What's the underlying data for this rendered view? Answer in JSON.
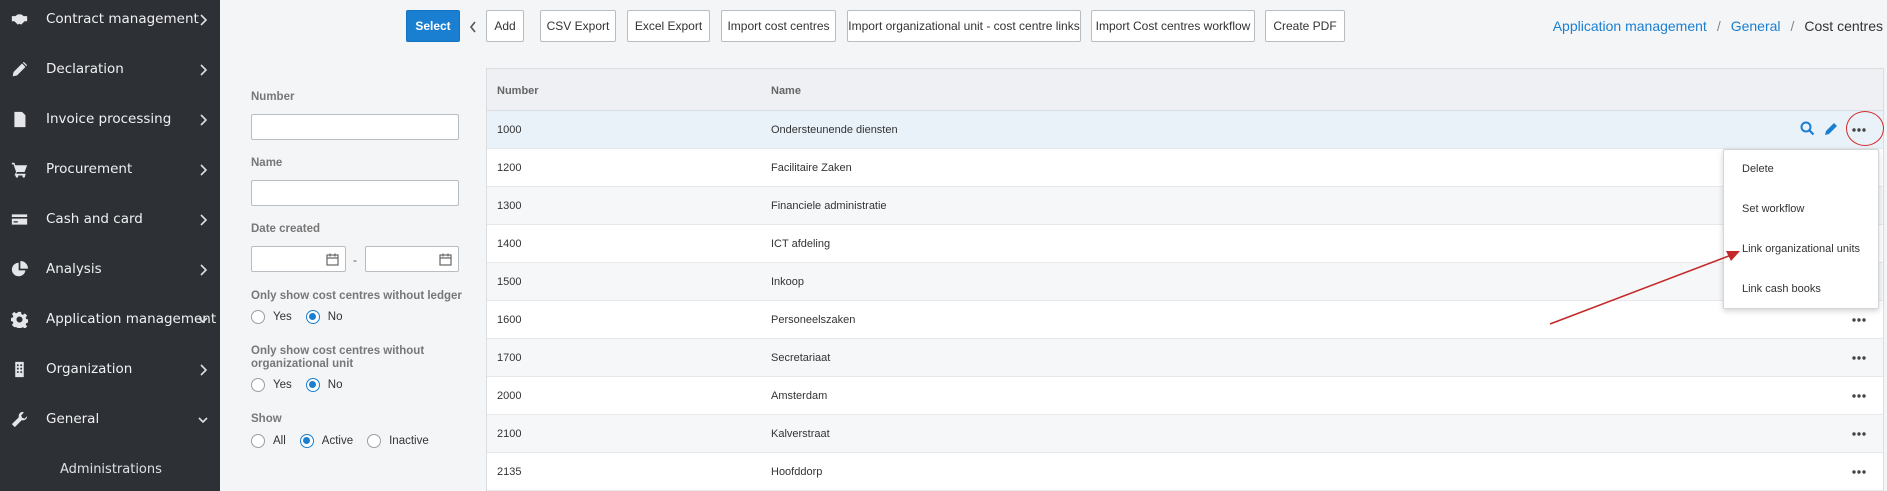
{
  "sidebar": {
    "items": [
      {
        "label": "Contract management",
        "icon": "handshake-icon",
        "chevron": "right"
      },
      {
        "label": "Declaration",
        "icon": "pencil-icon",
        "chevron": "right"
      },
      {
        "label": "Invoice processing",
        "icon": "invoice-icon",
        "chevron": "right"
      },
      {
        "label": "Procurement",
        "icon": "cart-icon",
        "chevron": "right"
      },
      {
        "label": "Cash and card",
        "icon": "card-icon",
        "chevron": "right"
      },
      {
        "label": "Analysis",
        "icon": "pie-chart-icon",
        "chevron": "right"
      },
      {
        "label": "Application management",
        "icon": "gear-icon",
        "chevron": "down"
      },
      {
        "label": "Organization",
        "icon": "building-icon",
        "chevron": "right"
      },
      {
        "label": "General",
        "icon": "wrench-icon",
        "chevron": "down"
      }
    ],
    "sub_item": "Administrations"
  },
  "toolbar": {
    "select": "Select",
    "add": "Add",
    "csv_export": "CSV Export",
    "excel_export": "Excel Export",
    "import_cost_centres": "Import cost centres",
    "import_org_links": "Import organizational unit - cost centre links",
    "import_workflow": "Import Cost centres workflow",
    "create_pdf": "Create PDF"
  },
  "breadcrumb": {
    "app_mgmt": "Application management",
    "general": "General",
    "current": "Cost centres",
    "sep": "/"
  },
  "filters": {
    "number_label": "Number",
    "name_label": "Name",
    "date_label": "Date created",
    "date_sep": "-",
    "ledger_label": "Only show cost centres without ledger",
    "orgunit_label_1": "Only show cost centres without",
    "orgunit_label_2": "organizational unit",
    "show_label": "Show",
    "yes": "Yes",
    "no": "No",
    "all": "All",
    "active": "Active",
    "inactive": "Inactive"
  },
  "table": {
    "col_number": "Number",
    "col_name": "Name",
    "rows": [
      {
        "number": "1000",
        "name": "Ondersteunende diensten"
      },
      {
        "number": "1200",
        "name": "Facilitaire Zaken"
      },
      {
        "number": "1300",
        "name": "Financiele administratie"
      },
      {
        "number": "1400",
        "name": "ICT afdeling"
      },
      {
        "number": "1500",
        "name": "Inkoop"
      },
      {
        "number": "1600",
        "name": "Personeelszaken"
      },
      {
        "number": "1700",
        "name": "Secretariaat"
      },
      {
        "number": "2000",
        "name": "Amsterdam"
      },
      {
        "number": "2100",
        "name": "Kalverstraat"
      },
      {
        "number": "2135",
        "name": "Hoofddorp"
      }
    ]
  },
  "dropdown": {
    "delete": "Delete",
    "set_workflow": "Set workflow",
    "link_org_units": "Link organizational units",
    "link_cash_books": "Link cash books"
  },
  "colors": {
    "sidebar_bg": "#2d3035",
    "accent": "#1a7fd1",
    "highlight_annotation": "#d62b2b"
  }
}
